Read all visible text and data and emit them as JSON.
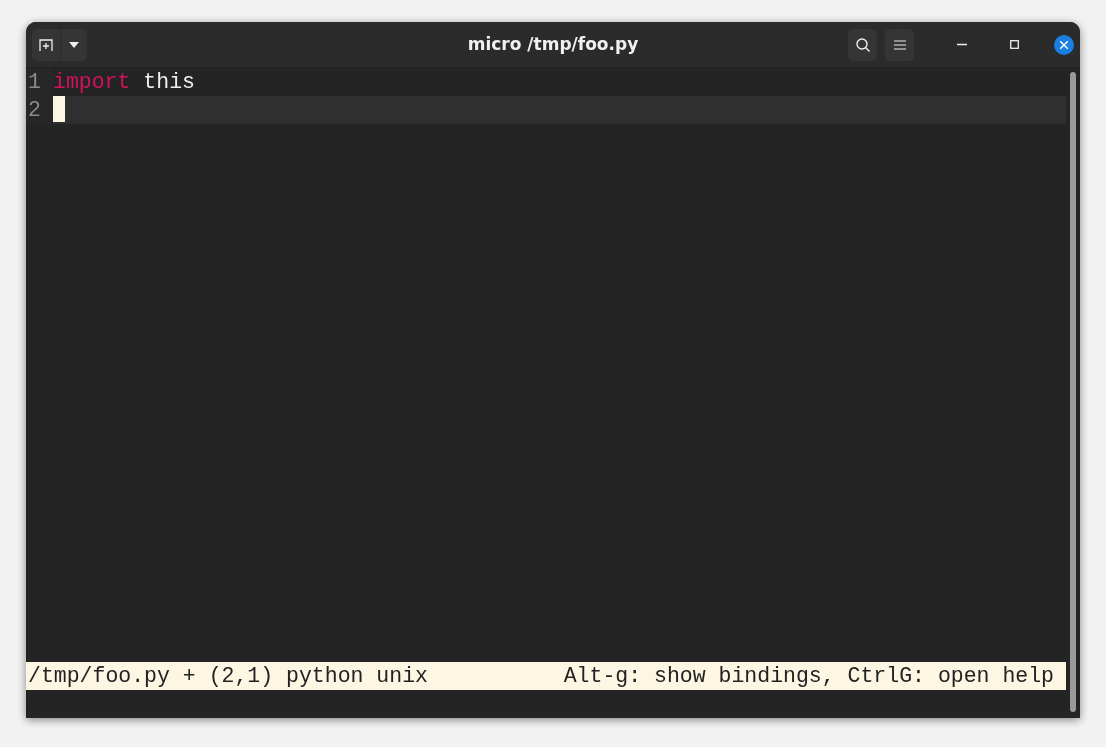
{
  "window": {
    "title": "micro /tmp/foo.py"
  },
  "editor": {
    "lines": [
      {
        "number": "1",
        "current": false,
        "tokens": [
          {
            "kind": "keyword",
            "text": "import"
          },
          {
            "kind": "plain",
            "text": " this"
          }
        ]
      },
      {
        "number": "2",
        "current": true
      }
    ]
  },
  "status_bar": {
    "left": "/tmp/foo.py + (2,1) python unix",
    "right": "Alt-g: show bindings, CtrlG: open help"
  }
}
